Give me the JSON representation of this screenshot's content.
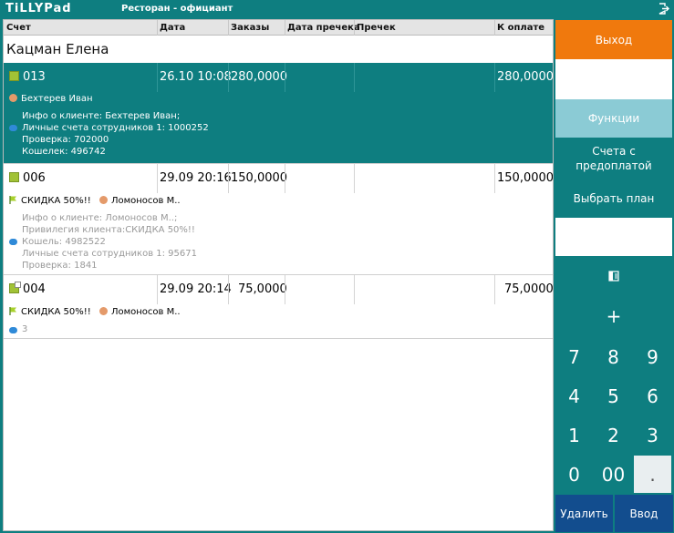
{
  "app": {
    "logo": "TiLLYPad",
    "title": "Ресторан - официант"
  },
  "columns": [
    "Счет",
    "Дата",
    "Заказы",
    "Дата пречека",
    "Пречек",
    "К оплате"
  ],
  "waiter": "Кацман Елена",
  "orders": [
    {
      "number": "013",
      "date": "26.10 10:08",
      "orders": "280,0000",
      "pay": "280,0000",
      "guest": "Бехтерев Иван",
      "info": [
        "Инфо о клиенте: Бехтерев Иван;",
        "Личные счета сотрудников 1: 1000252",
        "Проверка: 702000",
        "Кошелек: 496742"
      ]
    },
    {
      "number": "006",
      "date": "29.09 20:16",
      "orders": "150,0000",
      "pay": "150,0000",
      "discount": "СКИДКА 50%!!",
      "guest": "Ломоносов М..",
      "info": [
        "Инфо о клиенте: Ломоносов М..;",
        "Привилегия клиента:СКИДКА 50%!!",
        "Кошель: 4982522",
        "Личные счета сотрудников 1: 95671",
        "Проверка: 1841"
      ]
    },
    {
      "number": "004",
      "date": "29.09 20:14",
      "orders": "75,0000",
      "pay": "75,0000",
      "discount": "СКИДКА 50%!!",
      "guest": "Ломоносов М..",
      "info": [
        "3"
      ]
    }
  ],
  "side": {
    "exit": "Выход",
    "functions": "Функции",
    "prepaid": "Счета с предоплатой",
    "plan": "Выбрать план",
    "plus": "+",
    "keys": [
      "7",
      "8",
      "9",
      "4",
      "5",
      "6",
      "1",
      "2",
      "3",
      "0",
      "00",
      "."
    ],
    "delete": "Удалить",
    "enter": "Ввод"
  },
  "colors": {
    "teal": "#0e7e80",
    "orange": "#f0790d",
    "light_teal": "#8bcbd5",
    "navy": "#124d8e",
    "square": "#a1c236"
  }
}
